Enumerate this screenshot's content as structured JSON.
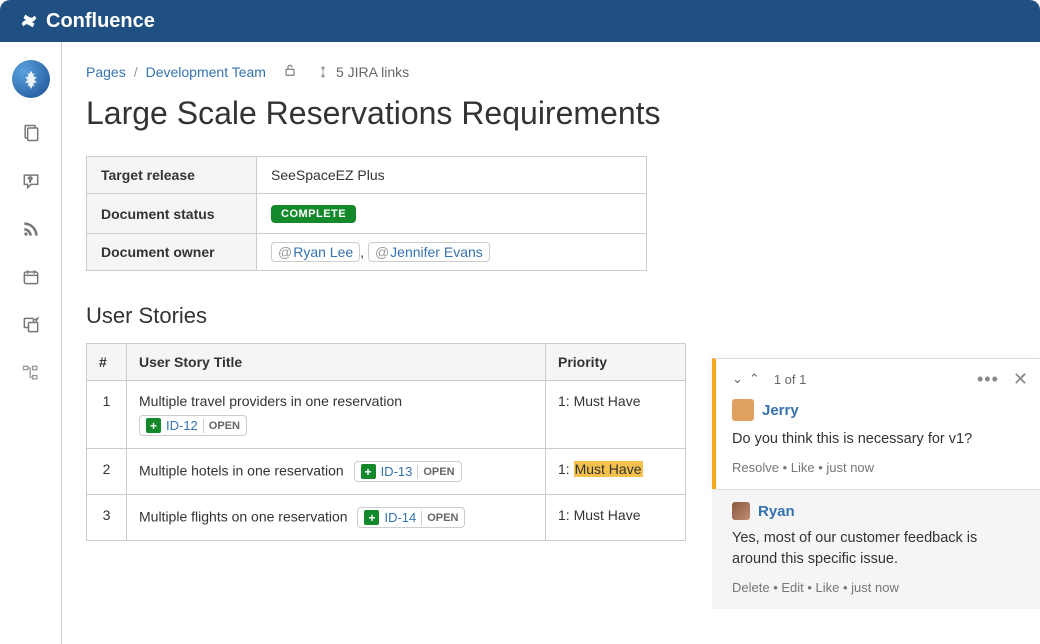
{
  "app": {
    "name": "Confluence"
  },
  "breadcrumb": {
    "root": "Pages",
    "space": "Development Team",
    "jira_links_label": "5 JIRA links"
  },
  "page": {
    "title": "Large Scale Reservations Requirements"
  },
  "meta": {
    "target_release_label": "Target release",
    "target_release_value": "SeeSpaceEZ Plus",
    "status_label": "Document status",
    "status_value": "COMPLETE",
    "owner_label": "Document owner",
    "owners": [
      "Ryan Lee",
      "Jennifer Evans"
    ]
  },
  "stories": {
    "heading": "User Stories",
    "columns": {
      "num": "#",
      "title": "User Story Title",
      "priority": "Priority"
    },
    "rows": [
      {
        "n": "1",
        "title": "Multiple travel providers in one reservation",
        "jira_id": "ID-12",
        "jira_status": "OPEN",
        "priority": "1: Must Have",
        "highlight": false,
        "inline": false
      },
      {
        "n": "2",
        "title": "Multiple hotels in one reservation",
        "jira_id": "ID-13",
        "jira_status": "OPEN",
        "priority_prefix": "1: ",
        "priority_hl": "Must Have",
        "highlight": true,
        "inline": true
      },
      {
        "n": "3",
        "title": "Multiple flights on one reservation",
        "jira_id": "ID-14",
        "jira_status": "OPEN",
        "priority": "1: Must Have",
        "highlight": false,
        "inline": true
      }
    ]
  },
  "comments": {
    "counter": "1 of 1",
    "thread": [
      {
        "author": "Jerry",
        "text": "Do you think this is necessary for v1?",
        "actions": "Resolve • Like • just now"
      },
      {
        "author": "Ryan",
        "text": "Yes, most of our customer feedback is around this specific issue.",
        "actions": "Delete • Edit • Like • just now"
      }
    ]
  }
}
